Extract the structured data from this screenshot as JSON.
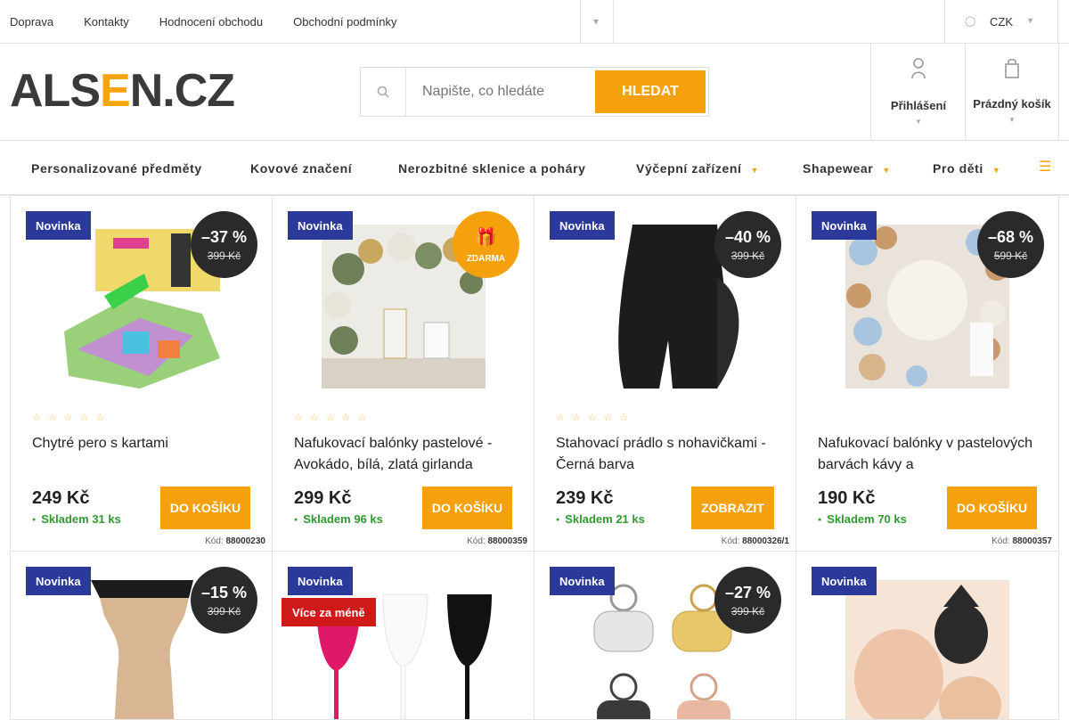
{
  "topbar": {
    "links": [
      "Doprava",
      "Kontakty",
      "Hodnocení obchodu",
      "Obchodní podmínky"
    ],
    "currency": "CZK"
  },
  "header": {
    "logo": {
      "part1": "ALS",
      "part2": "E",
      "part3": "N.CZ"
    },
    "search_placeholder": "Napište, co hledáte",
    "search_button": "HLEDAT",
    "login_label": "Přihlášení",
    "cart_label": "Prázdný košík"
  },
  "nav": {
    "items": [
      "Personalizované předměty",
      "Kovové značení",
      "Nerozbitné sklenice a poháry",
      "Výčepní zařízení",
      "Shapewear",
      "Pro děti"
    ]
  },
  "products": [
    {
      "badge": "Novinka",
      "discount": "–37 %",
      "old_price": "399 Kč",
      "name": "Chytré pero s kartami",
      "price": "249 Kč",
      "stock": "Skladem 31 ks",
      "button": "DO KOŠÍKU",
      "code_label": "Kód:",
      "code": "88000230"
    },
    {
      "badge": "Novinka",
      "free_label": "ZDARMA",
      "name": "Nafukovací balónky pastelové - Avokádo, bílá, zlatá girlanda",
      "price": "299 Kč",
      "stock": "Skladem 96 ks",
      "button": "DO KOŠÍKU",
      "code_label": "Kód:",
      "code": "88000359"
    },
    {
      "badge": "Novinka",
      "discount": "–40 %",
      "old_price": "399 Kč",
      "name": "Stahovací prádlo s nohavičkami - Černá barva",
      "price": "239 Kč",
      "stock": "Skladem 21 ks",
      "button": "ZOBRAZIT",
      "code_label": "Kód:",
      "code": "88000326/1"
    },
    {
      "badge": "Novinka",
      "discount": "–68 %",
      "old_price": "599 Kč",
      "name": "Nafukovací balónky v pastelových barvách kávy a",
      "price": "190 Kč",
      "stock": "Skladem 70 ks",
      "button": "DO KOŠÍKU",
      "code_label": "Kód:",
      "code": "88000357"
    },
    {
      "badge": "Novinka",
      "discount": "–15 %",
      "old_price": "399 Kč"
    },
    {
      "badge": "Novinka",
      "badge2": "Více za méně"
    },
    {
      "badge": "Novinka",
      "discount": "–27 %",
      "old_price": "399 Kč"
    },
    {
      "badge": "Novinka"
    }
  ],
  "colors": {
    "accent": "#f5a10d",
    "badge_blue": "#2b3a9a",
    "stock_green": "#2e9a2e",
    "sale_red": "#d01a1a",
    "dark": "#2a2a2a"
  }
}
